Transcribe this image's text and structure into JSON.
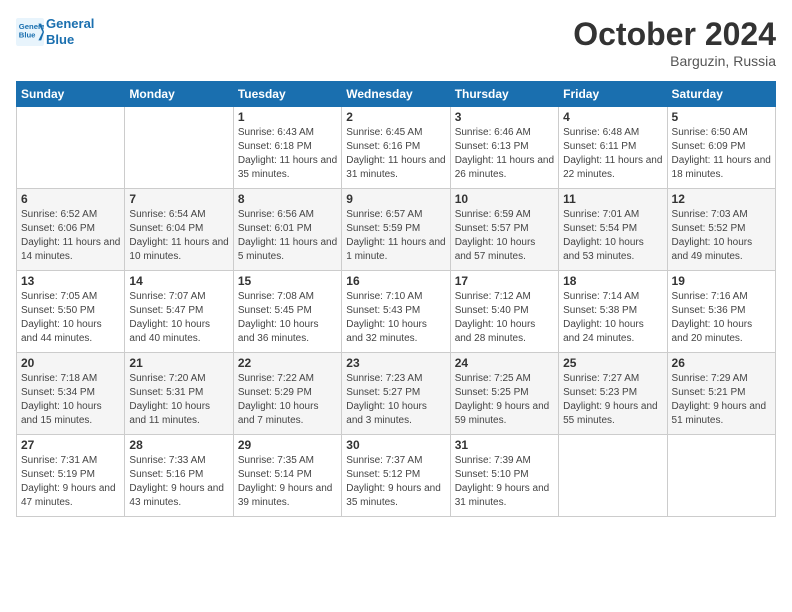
{
  "header": {
    "logo_line1": "General",
    "logo_line2": "Blue",
    "month": "October 2024",
    "location": "Barguzin, Russia"
  },
  "days_of_week": [
    "Sunday",
    "Monday",
    "Tuesday",
    "Wednesday",
    "Thursday",
    "Friday",
    "Saturday"
  ],
  "weeks": [
    [
      {
        "day": "",
        "sunrise": "",
        "sunset": "",
        "daylight": ""
      },
      {
        "day": "",
        "sunrise": "",
        "sunset": "",
        "daylight": ""
      },
      {
        "day": "1",
        "sunrise": "Sunrise: 6:43 AM",
        "sunset": "Sunset: 6:18 PM",
        "daylight": "Daylight: 11 hours and 35 minutes."
      },
      {
        "day": "2",
        "sunrise": "Sunrise: 6:45 AM",
        "sunset": "Sunset: 6:16 PM",
        "daylight": "Daylight: 11 hours and 31 minutes."
      },
      {
        "day": "3",
        "sunrise": "Sunrise: 6:46 AM",
        "sunset": "Sunset: 6:13 PM",
        "daylight": "Daylight: 11 hours and 26 minutes."
      },
      {
        "day": "4",
        "sunrise": "Sunrise: 6:48 AM",
        "sunset": "Sunset: 6:11 PM",
        "daylight": "Daylight: 11 hours and 22 minutes."
      },
      {
        "day": "5",
        "sunrise": "Sunrise: 6:50 AM",
        "sunset": "Sunset: 6:09 PM",
        "daylight": "Daylight: 11 hours and 18 minutes."
      }
    ],
    [
      {
        "day": "6",
        "sunrise": "Sunrise: 6:52 AM",
        "sunset": "Sunset: 6:06 PM",
        "daylight": "Daylight: 11 hours and 14 minutes."
      },
      {
        "day": "7",
        "sunrise": "Sunrise: 6:54 AM",
        "sunset": "Sunset: 6:04 PM",
        "daylight": "Daylight: 11 hours and 10 minutes."
      },
      {
        "day": "8",
        "sunrise": "Sunrise: 6:56 AM",
        "sunset": "Sunset: 6:01 PM",
        "daylight": "Daylight: 11 hours and 5 minutes."
      },
      {
        "day": "9",
        "sunrise": "Sunrise: 6:57 AM",
        "sunset": "Sunset: 5:59 PM",
        "daylight": "Daylight: 11 hours and 1 minute."
      },
      {
        "day": "10",
        "sunrise": "Sunrise: 6:59 AM",
        "sunset": "Sunset: 5:57 PM",
        "daylight": "Daylight: 10 hours and 57 minutes."
      },
      {
        "day": "11",
        "sunrise": "Sunrise: 7:01 AM",
        "sunset": "Sunset: 5:54 PM",
        "daylight": "Daylight: 10 hours and 53 minutes."
      },
      {
        "day": "12",
        "sunrise": "Sunrise: 7:03 AM",
        "sunset": "Sunset: 5:52 PM",
        "daylight": "Daylight: 10 hours and 49 minutes."
      }
    ],
    [
      {
        "day": "13",
        "sunrise": "Sunrise: 7:05 AM",
        "sunset": "Sunset: 5:50 PM",
        "daylight": "Daylight: 10 hours and 44 minutes."
      },
      {
        "day": "14",
        "sunrise": "Sunrise: 7:07 AM",
        "sunset": "Sunset: 5:47 PM",
        "daylight": "Daylight: 10 hours and 40 minutes."
      },
      {
        "day": "15",
        "sunrise": "Sunrise: 7:08 AM",
        "sunset": "Sunset: 5:45 PM",
        "daylight": "Daylight: 10 hours and 36 minutes."
      },
      {
        "day": "16",
        "sunrise": "Sunrise: 7:10 AM",
        "sunset": "Sunset: 5:43 PM",
        "daylight": "Daylight: 10 hours and 32 minutes."
      },
      {
        "day": "17",
        "sunrise": "Sunrise: 7:12 AM",
        "sunset": "Sunset: 5:40 PM",
        "daylight": "Daylight: 10 hours and 28 minutes."
      },
      {
        "day": "18",
        "sunrise": "Sunrise: 7:14 AM",
        "sunset": "Sunset: 5:38 PM",
        "daylight": "Daylight: 10 hours and 24 minutes."
      },
      {
        "day": "19",
        "sunrise": "Sunrise: 7:16 AM",
        "sunset": "Sunset: 5:36 PM",
        "daylight": "Daylight: 10 hours and 20 minutes."
      }
    ],
    [
      {
        "day": "20",
        "sunrise": "Sunrise: 7:18 AM",
        "sunset": "Sunset: 5:34 PM",
        "daylight": "Daylight: 10 hours and 15 minutes."
      },
      {
        "day": "21",
        "sunrise": "Sunrise: 7:20 AM",
        "sunset": "Sunset: 5:31 PM",
        "daylight": "Daylight: 10 hours and 11 minutes."
      },
      {
        "day": "22",
        "sunrise": "Sunrise: 7:22 AM",
        "sunset": "Sunset: 5:29 PM",
        "daylight": "Daylight: 10 hours and 7 minutes."
      },
      {
        "day": "23",
        "sunrise": "Sunrise: 7:23 AM",
        "sunset": "Sunset: 5:27 PM",
        "daylight": "Daylight: 10 hours and 3 minutes."
      },
      {
        "day": "24",
        "sunrise": "Sunrise: 7:25 AM",
        "sunset": "Sunset: 5:25 PM",
        "daylight": "Daylight: 9 hours and 59 minutes."
      },
      {
        "day": "25",
        "sunrise": "Sunrise: 7:27 AM",
        "sunset": "Sunset: 5:23 PM",
        "daylight": "Daylight: 9 hours and 55 minutes."
      },
      {
        "day": "26",
        "sunrise": "Sunrise: 7:29 AM",
        "sunset": "Sunset: 5:21 PM",
        "daylight": "Daylight: 9 hours and 51 minutes."
      }
    ],
    [
      {
        "day": "27",
        "sunrise": "Sunrise: 7:31 AM",
        "sunset": "Sunset: 5:19 PM",
        "daylight": "Daylight: 9 hours and 47 minutes."
      },
      {
        "day": "28",
        "sunrise": "Sunrise: 7:33 AM",
        "sunset": "Sunset: 5:16 PM",
        "daylight": "Daylight: 9 hours and 43 minutes."
      },
      {
        "day": "29",
        "sunrise": "Sunrise: 7:35 AM",
        "sunset": "Sunset: 5:14 PM",
        "daylight": "Daylight: 9 hours and 39 minutes."
      },
      {
        "day": "30",
        "sunrise": "Sunrise: 7:37 AM",
        "sunset": "Sunset: 5:12 PM",
        "daylight": "Daylight: 9 hours and 35 minutes."
      },
      {
        "day": "31",
        "sunrise": "Sunrise: 7:39 AM",
        "sunset": "Sunset: 5:10 PM",
        "daylight": "Daylight: 9 hours and 31 minutes."
      },
      {
        "day": "",
        "sunrise": "",
        "sunset": "",
        "daylight": ""
      },
      {
        "day": "",
        "sunrise": "",
        "sunset": "",
        "daylight": ""
      }
    ]
  ]
}
